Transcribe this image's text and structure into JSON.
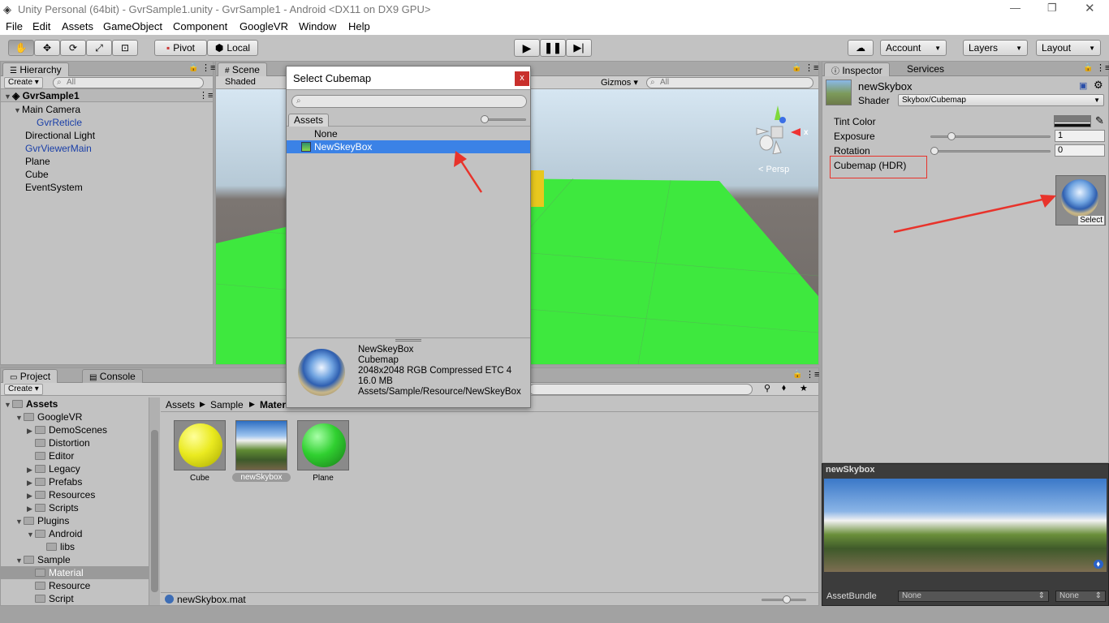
{
  "window": {
    "title": "Unity Personal (64bit) - GvrSample1.unity - GvrSample1 - Android <DX11 on DX9 GPU>"
  },
  "menu": [
    "File",
    "Edit",
    "Assets",
    "GameObject",
    "Component",
    "GoogleVR",
    "Window",
    "Help"
  ],
  "toolbar": {
    "pivot": "Pivot",
    "local": "Local",
    "account": "Account",
    "layers": "Layers",
    "layout": "Layout"
  },
  "hierarchy": {
    "tab": "Hierarchy",
    "create": "Create",
    "search_placeholder": "All",
    "scene": "GvrSample1",
    "items": [
      {
        "label": "Main Camera",
        "blue": false
      },
      {
        "label": "GvrReticle",
        "blue": true
      },
      {
        "label": "Directional Light",
        "blue": false
      },
      {
        "label": "GvrViewerMain",
        "blue": true
      },
      {
        "label": "Plane",
        "blue": false
      },
      {
        "label": "Cube",
        "blue": false
      },
      {
        "label": "EventSystem",
        "blue": false
      }
    ]
  },
  "scene": {
    "tab": "Scene",
    "shading": "Shaded",
    "gizmos": "Gizmos",
    "search_placeholder": "All",
    "persp": "Persp",
    "gizmo_x": "x"
  },
  "dialog": {
    "title": "Select Cubemap",
    "close": "x",
    "assets_tab": "Assets",
    "items": [
      "None",
      "NewSkeyBox"
    ],
    "preview": {
      "name": "NewSkeyBox",
      "type": "Cubemap",
      "format": "2048x2048  RGB Compressed ETC 4",
      "size": "16.0 MB",
      "path": "Assets/Sample/Resource/NewSkeyBox"
    }
  },
  "inspector": {
    "tab": "Inspector",
    "services": "Services",
    "material_name": "newSkybox",
    "shader_label": "Shader",
    "shader_value": "Skybox/Cubemap",
    "tint_label": "Tint Color",
    "exposure_label": "Exposure",
    "exposure_value": "1",
    "rotation_label": "Rotation",
    "rotation_value": "0",
    "cubemap_label": "Cubemap   (HDR)",
    "select": "Select",
    "exposure_fraction": 0.15,
    "rotation_fraction": 0.0,
    "preview_title": "newSkybox",
    "assetbundle_label": "AssetBundle",
    "assetbundle_value": "None",
    "variant_value": "None"
  },
  "project": {
    "tab": "Project",
    "console": "Console",
    "create": "Create",
    "tree": [
      {
        "label": "Assets",
        "depth": 0,
        "bold": true
      },
      {
        "label": "GoogleVR",
        "depth": 1
      },
      {
        "label": "DemoScenes",
        "depth": 2
      },
      {
        "label": "Distortion",
        "depth": 2
      },
      {
        "label": "Editor",
        "depth": 2
      },
      {
        "label": "Legacy",
        "depth": 2
      },
      {
        "label": "Prefabs",
        "depth": 2
      },
      {
        "label": "Resources",
        "depth": 2
      },
      {
        "label": "Scripts",
        "depth": 2
      },
      {
        "label": "Plugins",
        "depth": 1
      },
      {
        "label": "Android",
        "depth": 2
      },
      {
        "label": "libs",
        "depth": 3
      },
      {
        "label": "Sample",
        "depth": 1
      },
      {
        "label": "Material",
        "depth": 2,
        "selected": true
      },
      {
        "label": "Resource",
        "depth": 2
      },
      {
        "label": "Script",
        "depth": 2
      }
    ],
    "breadcrumb": [
      "Assets",
      "Sample",
      "Materi..."
    ],
    "assets": [
      "Cube",
      "newSkybox",
      "Plane"
    ],
    "status_file": "newSkybox.mat"
  },
  "colors": {
    "accent": "#3b82e6",
    "ground": "#3ee83e",
    "highlight_red": "#e8332b"
  }
}
